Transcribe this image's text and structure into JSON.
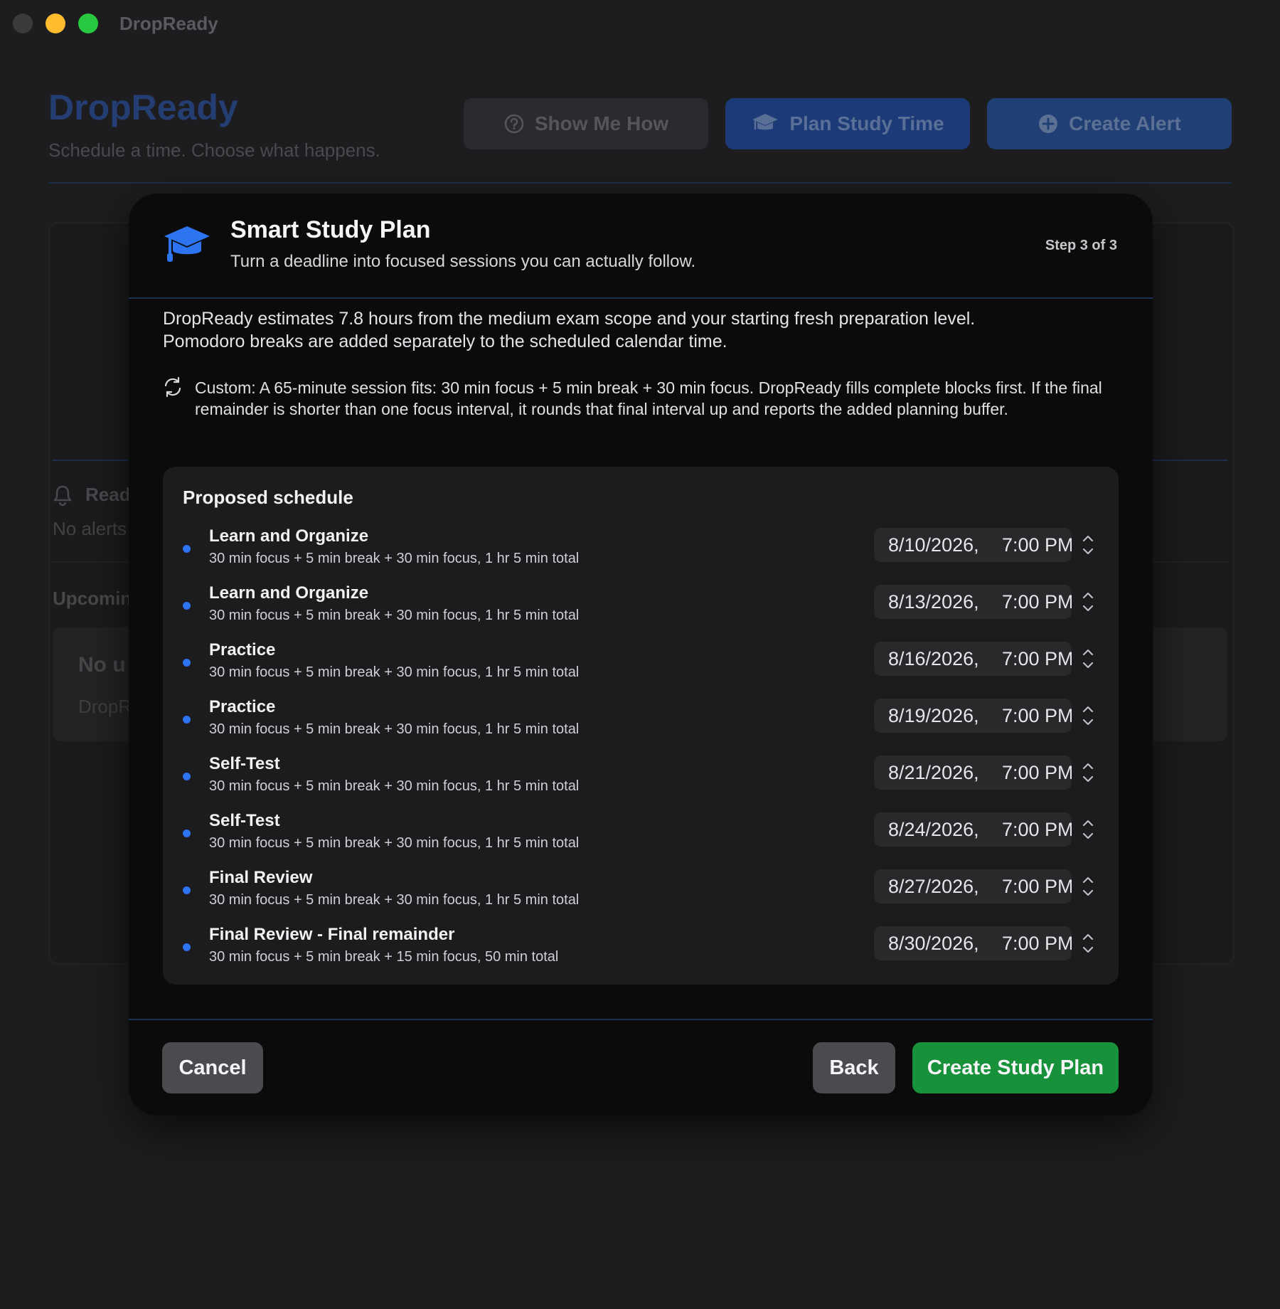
{
  "window": {
    "title": "DropReady"
  },
  "header": {
    "brand": "DropReady",
    "tagline": "Schedule a time. Choose what happens.",
    "show_me_how": "Show Me How",
    "plan_study_time": "Plan Study Time",
    "create_alert": "Create Alert"
  },
  "background": {
    "ready_label": "Read",
    "no_alerts": "No alerts",
    "upcoming": "Upcomin",
    "no_upcoming": "No u",
    "dropready_text": "DropR"
  },
  "modal": {
    "title": "Smart Study Plan",
    "subtitle": "Turn a deadline into focused sessions you can actually follow.",
    "step": "Step 3 of 3",
    "desc_line1": "DropReady estimates 7.8 hours from the medium exam scope and your starting fresh preparation level.",
    "desc_line2": "Pomodoro breaks are added separately to the scheduled calendar time.",
    "custom_note": "Custom: A 65-minute session fits: 30 min focus + 5 min break + 30 min focus. DropReady fills complete blocks first. If the final remainder is shorter than one focus interval, it rounds that final interval up and reports the added planning buffer.",
    "schedule_title": "Proposed schedule",
    "sessions": [
      {
        "name": "Learn and Organize",
        "detail": "30 min focus + 5 min break + 30 min focus, 1 hr 5 min total",
        "date": "8/10/2026,",
        "time": "7:00 PM"
      },
      {
        "name": "Learn and Organize",
        "detail": "30 min focus + 5 min break + 30 min focus, 1 hr 5 min total",
        "date": "8/13/2026,",
        "time": "7:00 PM"
      },
      {
        "name": "Practice",
        "detail": "30 min focus + 5 min break + 30 min focus, 1 hr 5 min total",
        "date": "8/16/2026,",
        "time": "7:00 PM"
      },
      {
        "name": "Practice",
        "detail": "30 min focus + 5 min break + 30 min focus, 1 hr 5 min total",
        "date": "8/19/2026,",
        "time": "7:00 PM"
      },
      {
        "name": "Self-Test",
        "detail": "30 min focus + 5 min break + 30 min focus, 1 hr 5 min total",
        "date": "8/21/2026,",
        "time": "7:00 PM"
      },
      {
        "name": "Self-Test",
        "detail": "30 min focus + 5 min break + 30 min focus, 1 hr 5 min total",
        "date": "8/24/2026,",
        "time": "7:00 PM"
      },
      {
        "name": "Final Review",
        "detail": "30 min focus + 5 min break + 30 min focus, 1 hr 5 min total",
        "date": "8/27/2026,",
        "time": "7:00 PM"
      },
      {
        "name": "Final Review - Final remainder",
        "detail": "30 min focus + 5 min break + 15 min focus, 50 min total",
        "date": "8/30/2026,",
        "time": "7:00 PM"
      }
    ],
    "cancel": "Cancel",
    "back": "Back",
    "create": "Create Study Plan"
  },
  "colors": {
    "accent_blue": "#2d74f0",
    "create_green": "#18923a",
    "modal_bg": "#0b0b0c"
  }
}
